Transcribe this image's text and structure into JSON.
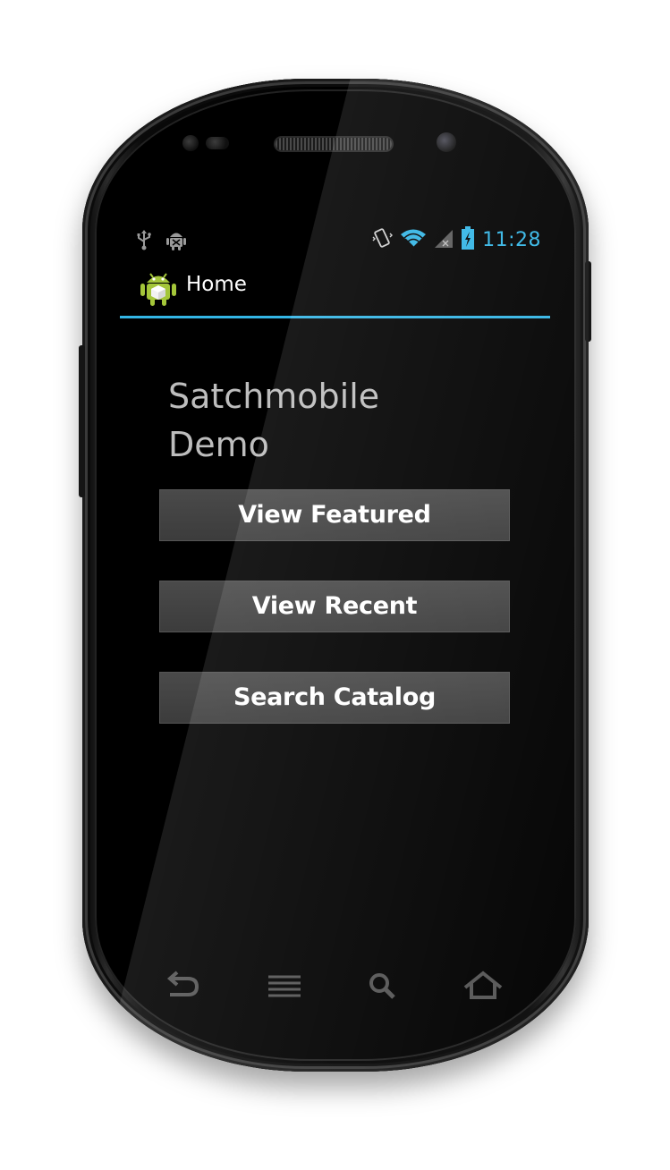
{
  "status_bar": {
    "time": "11:28",
    "accent_color": "#33b5e5",
    "left_icons": [
      "usb-icon",
      "android-debug-icon"
    ],
    "right_icons": [
      "vibrate-icon",
      "wifi-icon",
      "signal-icon",
      "battery-charging-icon"
    ]
  },
  "action_bar": {
    "title": "Home",
    "icon": "app-icon"
  },
  "main": {
    "heading": "Satchmobile Demo",
    "buttons": [
      {
        "label": "View Featured"
      },
      {
        "label": "View Recent"
      },
      {
        "label": "Search Catalog"
      }
    ]
  },
  "nav_bar": {
    "buttons": [
      "back-icon",
      "menu-icon",
      "search-icon",
      "home-icon"
    ]
  }
}
